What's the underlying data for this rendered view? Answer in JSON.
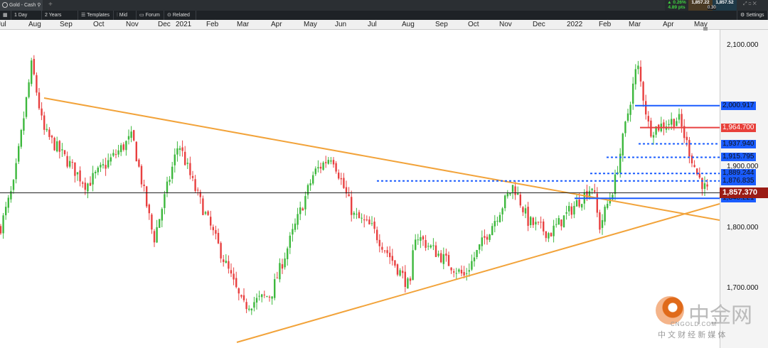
{
  "tabbar": {
    "instrument": "Gold - Cash",
    "add_tab": "+",
    "change_pct": "▲ 0.26%",
    "change_pts": "4.89 pts",
    "bid": "1,857.22",
    "ask": "1,857.52",
    "spread": "0.30",
    "settings": "Settings"
  },
  "toolbar": {
    "interval": "1 Day",
    "range": "2 Years",
    "templates": "Templates",
    "mid": "Mid",
    "forum": "Forum",
    "related": "Related"
  },
  "colors": {
    "up": "#3db83d",
    "down": "#e84040",
    "trend": "#f2a33a",
    "level": "#1a5cff"
  },
  "chart_data": {
    "type": "candlestick",
    "x_labels": [
      "Jul",
      "Aug",
      "Sep",
      "Oct",
      "Nov",
      "Dec",
      "2021",
      "Feb",
      "Mar",
      "Apr",
      "May",
      "Jun",
      "Jul",
      "Aug",
      "Sep",
      "Oct",
      "Nov",
      "Dec",
      "2022",
      "Feb",
      "Mar",
      "Apr",
      "May"
    ],
    "y_ticks": [
      "2,100.000",
      "1,900.000",
      "1,800.000",
      "1,700.000"
    ],
    "ylim": [
      1600,
      2130
    ],
    "price_path": [
      [
        0,
        1800
      ],
      [
        0.4,
        1870
      ],
      [
        0.95,
        2070
      ],
      [
        1.3,
        1960
      ],
      [
        2.6,
        1870
      ],
      [
        4,
        1950
      ],
      [
        4.65,
        1780
      ],
      [
        5.4,
        1940
      ],
      [
        5.85,
        1870
      ],
      [
        7.35,
        1670
      ],
      [
        8.2,
        1690
      ],
      [
        9.5,
        1890
      ],
      [
        10.05,
        1920
      ],
      [
        10.7,
        1820
      ],
      [
        11.25,
        1800
      ],
      [
        12.42,
        1700
      ],
      [
        12.55,
        1790
      ],
      [
        14.05,
        1720
      ],
      [
        15.55,
        1870
      ],
      [
        16,
        1810
      ],
      [
        16.65,
        1790
      ],
      [
        17.95,
        1870
      ],
      [
        18.15,
        1800
      ],
      [
        18.6,
        1870
      ],
      [
        19.3,
        2070
      ],
      [
        19.67,
        1960
      ],
      [
        20.55,
        1980
      ],
      [
        21.1,
        1890
      ],
      [
        21.4,
        1860
      ]
    ],
    "levels": [
      {
        "label": "2,000.917",
        "value": 2000.917,
        "style": "solid",
        "color": "blue"
      },
      {
        "label": "1,964.700",
        "value": 1964.7,
        "style": "solid",
        "color": "red"
      },
      {
        "label": "1,937.940",
        "value": 1937.94,
        "style": "dotted",
        "color": "blue"
      },
      {
        "label": "1,915.795",
        "value": 1915.795,
        "style": "dotted",
        "color": "blue"
      },
      {
        "label": "1,889.244",
        "value": 1889.244,
        "style": "dotted",
        "color": "blue"
      },
      {
        "label": "1,876.835",
        "value": 1876.835,
        "style": "dotted",
        "color": "blue"
      },
      {
        "label": "1,848.221",
        "value": 1848.221,
        "style": "solid",
        "color": "blue"
      }
    ],
    "current": {
      "label": "1,857.370",
      "value": 1857.37
    }
  },
  "watermark": {
    "brand": "中金网",
    "site": "CNGOLD.COM",
    "slogan": "中 文 财 经 新 媒 体"
  }
}
